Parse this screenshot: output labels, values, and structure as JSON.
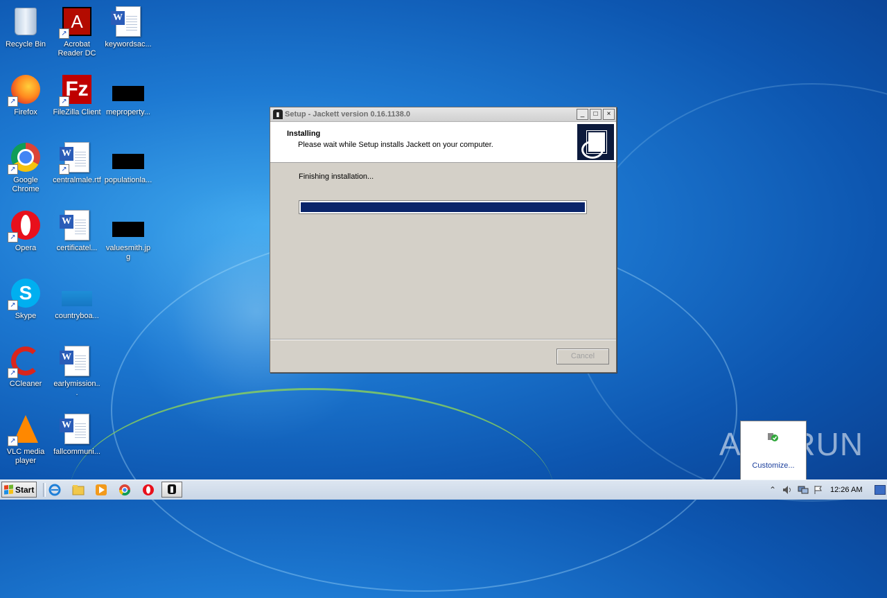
{
  "desktop": {
    "icons": [
      {
        "name": "recycle-bin",
        "label": "Recycle Bin"
      },
      {
        "name": "acrobat-reader",
        "label": "Acrobat Reader DC"
      },
      {
        "name": "keywordsac-doc",
        "label": "keywordsac..."
      },
      {
        "name": "firefox",
        "label": "Firefox"
      },
      {
        "name": "filezilla",
        "label": "FileZilla Client"
      },
      {
        "name": "meproperty-file",
        "label": "meproperty..."
      },
      {
        "name": "google-chrome",
        "label": "Google Chrome"
      },
      {
        "name": "centralmale-rtf",
        "label": "centralmale.rtf"
      },
      {
        "name": "populationla-file",
        "label": "populationla..."
      },
      {
        "name": "opera",
        "label": "Opera"
      },
      {
        "name": "certificatel-doc",
        "label": "certificatel..."
      },
      {
        "name": "valuesmith-jpg",
        "label": "valuesmith.jpg"
      },
      {
        "name": "skype",
        "label": "Skype"
      },
      {
        "name": "countryboa-file",
        "label": "countryboa..."
      },
      {
        "name": "ccleaner",
        "label": "CCleaner"
      },
      {
        "name": "earlymission-doc",
        "label": "earlymission..."
      },
      {
        "name": "vlc",
        "label": "VLC media player"
      },
      {
        "name": "fallcommun-doc",
        "label": "fallcommuni..."
      }
    ]
  },
  "dialog": {
    "title": "Setup - Jackett version 0.16.1138.0",
    "header_title": "Installing",
    "header_subtitle": "Please wait while Setup installs Jackett on your computer.",
    "status": "Finishing installation...",
    "progress": 1.0,
    "cancel_label": "Cancel",
    "btn_minimize": "_",
    "btn_maximize": "□",
    "btn_close": "×"
  },
  "notification": {
    "customize_label": "Customize..."
  },
  "watermark": "ANY.RUN",
  "taskbar": {
    "start_label": "Start",
    "clock": "12:26 AM",
    "pinned": [
      "internet-explorer",
      "windows-explorer",
      "media-player",
      "chrome",
      "opera",
      "jackett-setup"
    ]
  }
}
